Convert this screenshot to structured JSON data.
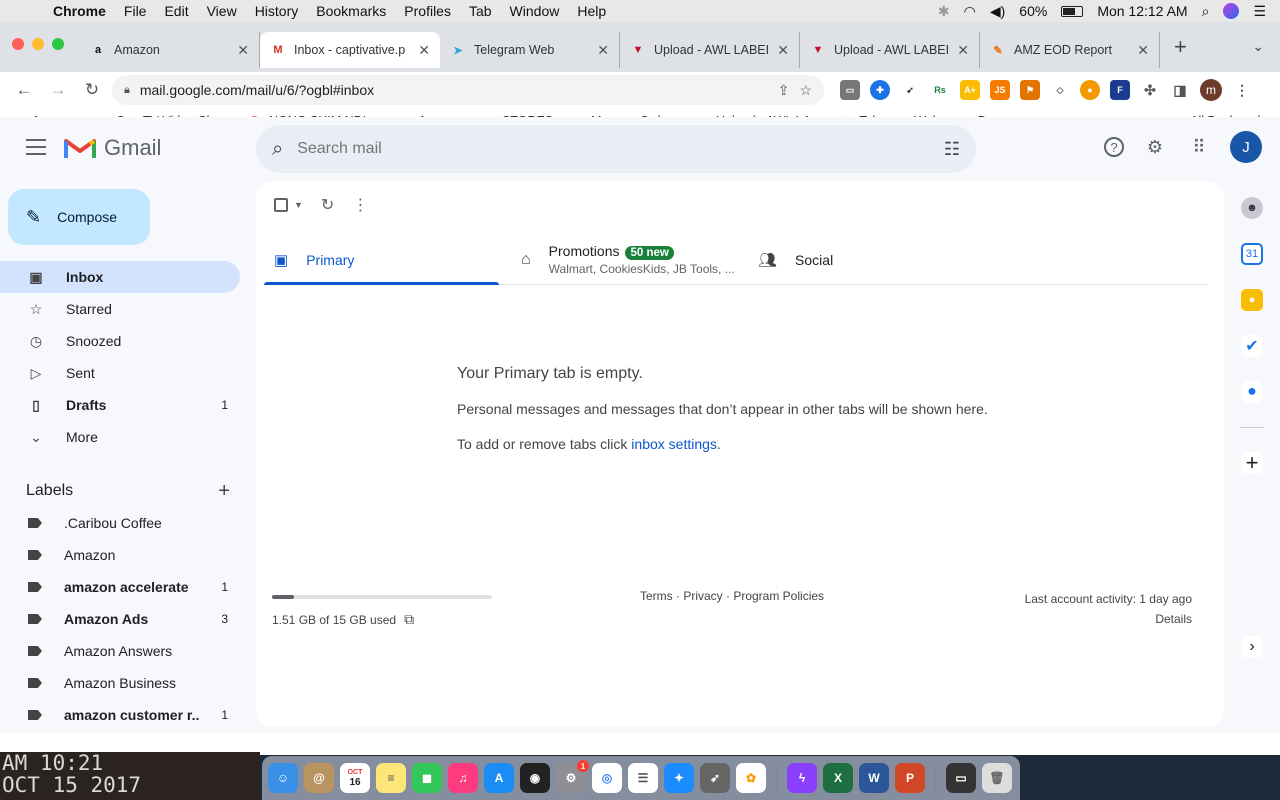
{
  "menubar": {
    "app": "Chrome",
    "items": [
      "File",
      "Edit",
      "View",
      "History",
      "Bookmarks",
      "Profiles",
      "Tab",
      "Window",
      "Help"
    ],
    "battery": "60%",
    "clock": "Mon 12:12 AM"
  },
  "tabs": [
    {
      "title": "Amazon",
      "icon": "amazon-icon",
      "fav": "a",
      "color": "#111111"
    },
    {
      "title": "Inbox - captivative.p",
      "icon": "gmail-icon",
      "fav": "M",
      "color": "#d93025"
    },
    {
      "title": "Telegram Web",
      "icon": "telegram-icon",
      "fav": "➤",
      "color": "#2aa3df"
    },
    {
      "title": "Upload - AWL LABEI",
      "icon": "awl-icon",
      "fav": "▼",
      "color": "#c8102e"
    },
    {
      "title": "Upload - AWL LABEI",
      "icon": "awl-icon",
      "fav": "▼",
      "color": "#c8102e"
    },
    {
      "title": "AMZ EOD Report",
      "icon": "report-icon",
      "fav": "✎",
      "color": "#e8710a"
    }
  ],
  "omnibox": {
    "url": "mail.google.com/mail/u/6/?ogbl#inbox"
  },
  "bookmarks": [
    {
      "label": "Amazon",
      "fav": "a",
      "color": "#111111"
    },
    {
      "label": "OmeTV Video Cha...",
      "fav": "◐",
      "color": "#555555"
    },
    {
      "label": "NONG SHIM NDL...",
      "fav": "P",
      "color": "#e60023"
    },
    {
      "label": "Amazon",
      "fav": "a",
      "color": "#111111"
    },
    {
      "label": "STORES",
      "fav": "▭",
      "color": "#777777"
    },
    {
      "label": "Manage Orders",
      "fav": "a",
      "color": "#111111"
    },
    {
      "label": "Upload - AWL LA...",
      "fav": "▼",
      "color": "#c8102e"
    },
    {
      "label": "Telegram Web",
      "fav": "➤",
      "color": "#2aa3df"
    },
    {
      "label": "Downey",
      "fav": "+",
      "color": "#188038"
    }
  ],
  "bookmarks_all": "All Bookmarks",
  "gmail": {
    "brand": "Gmail",
    "search_placeholder": "Search mail",
    "account_initial": "J",
    "compose": "Compose",
    "nav": [
      {
        "label": "Inbox",
        "count": "",
        "icon": "inbox-icon",
        "glyph": "▣"
      },
      {
        "label": "Starred",
        "count": "",
        "icon": "star-icon",
        "glyph": "☆"
      },
      {
        "label": "Snoozed",
        "count": "",
        "icon": "clock-icon",
        "glyph": "◷"
      },
      {
        "label": "Sent",
        "count": "",
        "icon": "send-icon",
        "glyph": "▷"
      },
      {
        "label": "Drafts",
        "count": "1",
        "icon": "draft-icon",
        "glyph": "▯"
      },
      {
        "label": "More",
        "count": "",
        "icon": "chevron-down-icon",
        "glyph": "⌄"
      }
    ],
    "labels_title": "Labels",
    "labels": [
      {
        "label": ".Caribou Coffee",
        "count": "",
        "bold": false
      },
      {
        "label": "Amazon",
        "count": "",
        "bold": false
      },
      {
        "label": "amazon accelerate",
        "count": "1",
        "bold": true
      },
      {
        "label": "Amazon Ads",
        "count": "3",
        "bold": true
      },
      {
        "label": "Amazon Answers",
        "count": "",
        "bold": false
      },
      {
        "label": "Amazon Business",
        "count": "",
        "bold": false
      },
      {
        "label": "amazon customer r...",
        "count": "1",
        "bold": true
      }
    ],
    "tabs": {
      "primary": "Primary",
      "promotions": "Promotions",
      "promotions_badge": "50 new",
      "promotions_sub": "Walmart, CookiesKids, JB Tools, ...",
      "social": "Social"
    },
    "empty": {
      "title": "Your Primary tab is empty.",
      "body": "Personal messages and messages that don’t appear in other tabs will be shown here.",
      "settings_prefix": "To add or remove tabs click",
      "settings_link": "inbox settings",
      "settings_suffix": "."
    },
    "footer": {
      "storage": "1.51 GB of 15 GB used",
      "storage_fraction": 0.1,
      "links": "Terms · Privacy · Program Policies",
      "activity": "Last account activity: 1 day ago",
      "details": "Details"
    }
  },
  "desktop": {
    "line1": "AM 10:21",
    "line2": "OCT 15 2017"
  },
  "dock": {
    "calendar_month": "OCT",
    "calendar_day": "16",
    "settings_badge": "1"
  }
}
